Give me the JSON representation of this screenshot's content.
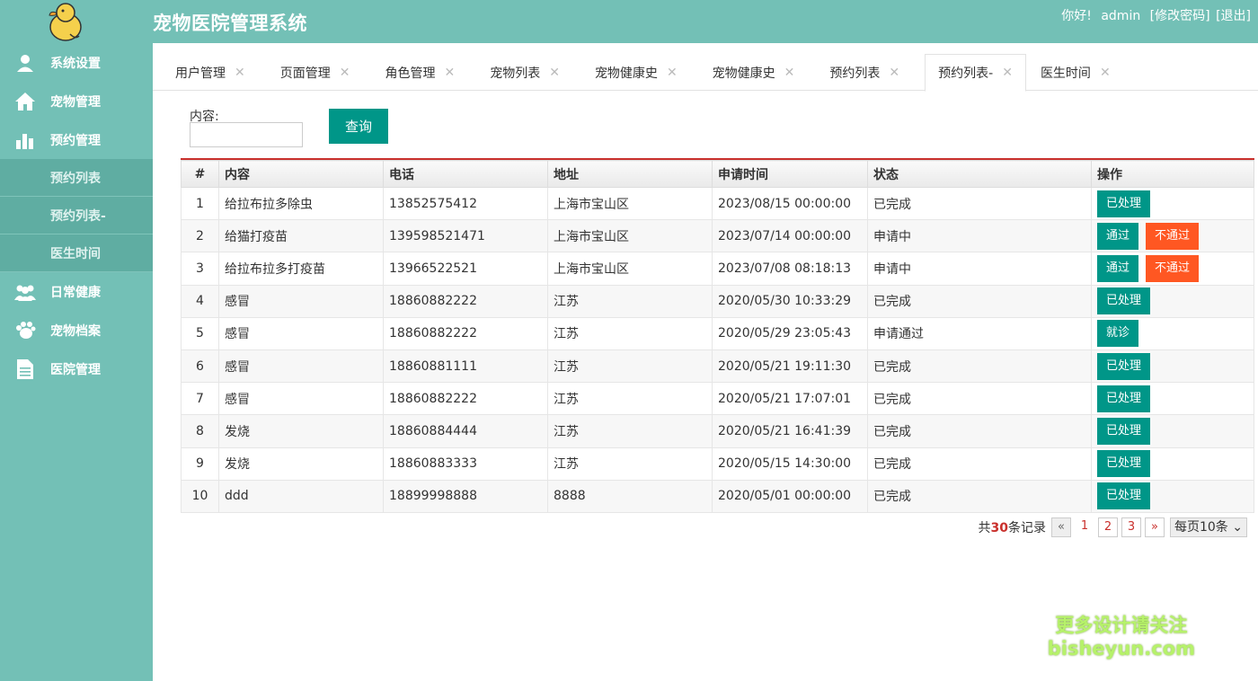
{
  "app": {
    "title": "宠物医院管理系统",
    "greeting": "你好!",
    "username": "admin",
    "change_password": "[修改密码]",
    "logout": "[退出]"
  },
  "sidebar": {
    "items": [
      {
        "label": "系统设置",
        "icon": "user-icon"
      },
      {
        "label": "宠物管理",
        "icon": "home-icon"
      },
      {
        "label": "预约管理",
        "icon": "bar-chart-icon"
      }
    ],
    "subitems": [
      "预约列表",
      "预约列表-",
      "医生时间"
    ],
    "items2": [
      {
        "label": "日常健康",
        "icon": "group-icon"
      },
      {
        "label": "宠物档案",
        "icon": "paw-icon"
      },
      {
        "label": "医院管理",
        "icon": "document-icon"
      }
    ]
  },
  "tabs": [
    "用户管理",
    "页面管理",
    "角色管理",
    "宠物列表",
    "宠物健康史",
    "宠物健康史",
    "预约列表",
    "预约列表-",
    "医生时间"
  ],
  "search": {
    "label": "内容:",
    "value": "",
    "button": "查询"
  },
  "table": {
    "headers": [
      "#",
      "内容",
      "电话",
      "地址",
      "申请时间",
      "状态",
      "操作"
    ],
    "rows": [
      {
        "n": "1",
        "content": "给拉布拉多除虫",
        "phone": "13852575412",
        "address": "上海市宝山区",
        "time": "2023/08/15 00:00:00",
        "status": "已完成",
        "actions": [
          "已处理"
        ]
      },
      {
        "n": "2",
        "content": "给猫打疫苗",
        "phone": "139598521471",
        "address": "上海市宝山区",
        "time": "2023/07/14 00:00:00",
        "status": "申请中",
        "actions": [
          "通过",
          "不通过"
        ]
      },
      {
        "n": "3",
        "content": "给拉布拉多打疫苗",
        "phone": "13966522521",
        "address": "上海市宝山区",
        "time": "2023/07/08 08:18:13",
        "status": "申请中",
        "actions": [
          "通过",
          "不通过"
        ]
      },
      {
        "n": "4",
        "content": "感冒",
        "phone": "18860882222",
        "address": "江苏",
        "time": "2020/05/30 10:33:29",
        "status": "已完成",
        "actions": [
          "已处理"
        ]
      },
      {
        "n": "5",
        "content": "感冒",
        "phone": "18860882222",
        "address": "江苏",
        "time": "2020/05/29 23:05:43",
        "status": "申请通过",
        "actions": [
          "就诊"
        ]
      },
      {
        "n": "6",
        "content": "感冒",
        "phone": "18860881111",
        "address": "江苏",
        "time": "2020/05/21 19:11:30",
        "status": "已完成",
        "actions": [
          "已处理"
        ]
      },
      {
        "n": "7",
        "content": "感冒",
        "phone": "18860882222",
        "address": "江苏",
        "time": "2020/05/21 17:07:01",
        "status": "已完成",
        "actions": [
          "已处理"
        ]
      },
      {
        "n": "8",
        "content": "发烧",
        "phone": "18860884444",
        "address": "江苏",
        "time": "2020/05/21 16:41:39",
        "status": "已完成",
        "actions": [
          "已处理"
        ]
      },
      {
        "n": "9",
        "content": "发烧",
        "phone": "18860883333",
        "address": "江苏",
        "time": "2020/05/15 14:30:00",
        "status": "已完成",
        "actions": [
          "已处理"
        ]
      },
      {
        "n": "10",
        "content": "ddd",
        "phone": "18899998888",
        "address": "8888",
        "time": "2020/05/01 00:00:00",
        "status": "已完成",
        "actions": [
          "已处理"
        ]
      }
    ]
  },
  "pager": {
    "total_prefix": "共",
    "total_count": "30",
    "total_suffix": "条记录",
    "prev": "«",
    "pages": [
      "1",
      "2",
      "3"
    ],
    "next": "»",
    "per_page": "每页10条"
  },
  "watermark": {
    "line1": "更多设计请关注",
    "line2": "bisheyun.com"
  },
  "colors": {
    "sidebar": "#73c0b6",
    "primary": "#009688",
    "danger": "#ff5722",
    "accent_red": "#c9302c"
  }
}
